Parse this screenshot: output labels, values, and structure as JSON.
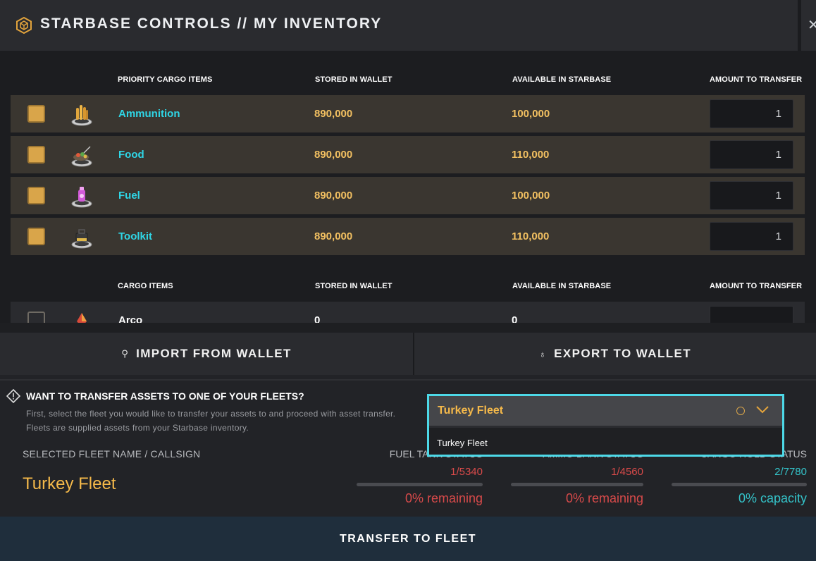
{
  "header": {
    "title": "STARBASE CONTROLS // MY INVENTORY",
    "icon": "cube-hex-icon",
    "close_icon": "close-icon"
  },
  "priority": {
    "columns": [
      "PRIORITY CARGO ITEMS",
      "STORED IN WALLET",
      "AVAILABLE IN STARBASE",
      "AMOUNT TO TRANSFER"
    ],
    "rows": [
      {
        "name": "Ammunition",
        "stored": "890,000",
        "available": "100,000",
        "amount": "1",
        "icon": "ammunition-icon",
        "checked": true
      },
      {
        "name": "Food",
        "stored": "890,000",
        "available": "110,000",
        "amount": "1",
        "icon": "food-icon",
        "checked": true
      },
      {
        "name": "Fuel",
        "stored": "890,000",
        "available": "100,000",
        "amount": "1",
        "icon": "fuel-icon",
        "checked": true
      },
      {
        "name": "Toolkit",
        "stored": "890,000",
        "available": "110,000",
        "amount": "1",
        "icon": "toolkit-icon",
        "checked": true
      }
    ]
  },
  "cargo": {
    "columns": [
      "CARGO ITEMS",
      "STORED IN WALLET",
      "AVAILABLE IN STARBASE",
      "AMOUNT TO TRANSFER"
    ],
    "rows": [
      {
        "name": "Arco",
        "stored": "0",
        "available": "0",
        "amount": "",
        "icon": "arco-icon",
        "checked": false
      }
    ]
  },
  "actions": {
    "import": "IMPORT FROM WALLET",
    "export": "EXPORT TO WALLET"
  },
  "fleet_prompt": {
    "title": "WANT TO TRANSFER ASSETS TO ONE OF YOUR FLEETS?",
    "description": "First, select the fleet you would like to transfer your assets to and proceed with asset transfer. Fleets are supplied assets from your Starbase inventory."
  },
  "selected": {
    "label": "SELECTED FLEET NAME / CALLSIGN",
    "value": "Turkey Fleet"
  },
  "stats": [
    {
      "label": "FUEL TANK STATUS",
      "value": "1/5340",
      "pct": "0% remaining",
      "color": "#d84a4a",
      "fill": 0
    },
    {
      "label": "AMMO BANK STATUS",
      "value": "1/4560",
      "pct": "0% remaining",
      "color": "#d84a4a",
      "fill": 0
    },
    {
      "label": "CARGO HOLD STATUS",
      "value": "2/7780",
      "pct": "0% capacity",
      "color": "#34c3c9",
      "fill": 0
    }
  ],
  "dropdown": {
    "selected": "Turkey Fleet",
    "options": [
      "Turkey Fleet"
    ]
  },
  "footer": {
    "transfer": "TRANSFER TO FLEET"
  },
  "colors": {
    "accent": "#4dd9e8",
    "gold": "#f5b94a",
    "danger": "#d84a4a",
    "teal": "#34c3c9"
  }
}
